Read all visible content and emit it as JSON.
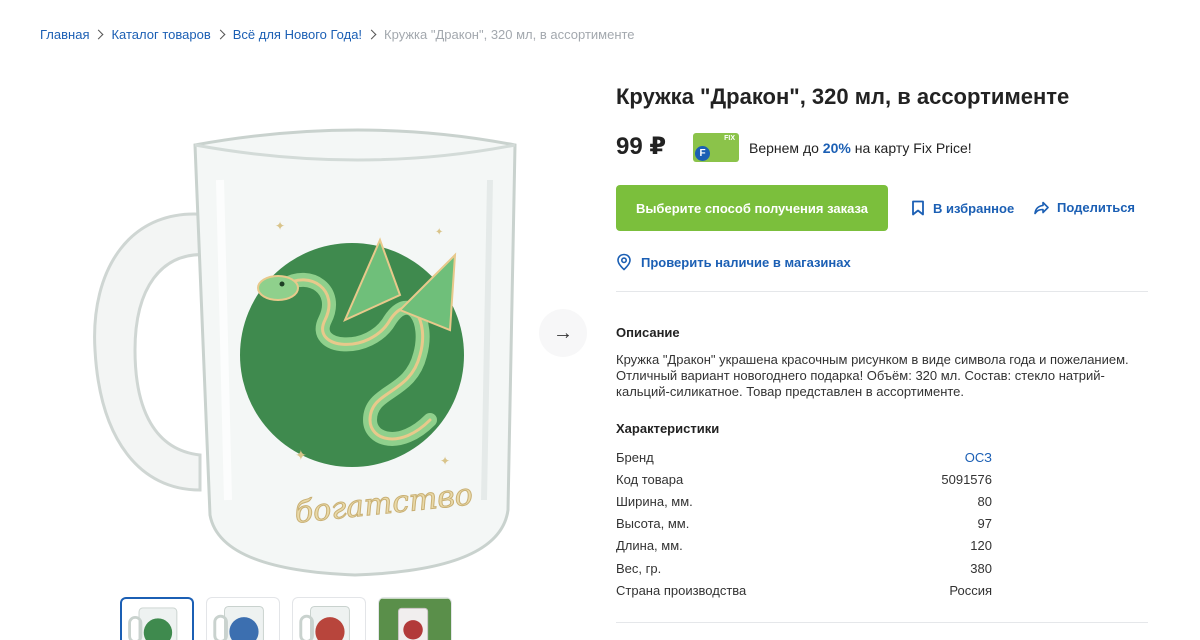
{
  "breadcrumb": {
    "items": [
      "Главная",
      "Каталог товаров",
      "Всё для Нового Года!"
    ],
    "current": "Кружка \"Дракон\", 320 мл, в ассортименте"
  },
  "product": {
    "title": "Кружка \"Дракон\", 320 мл, в ассортименте",
    "price": "99 ₽",
    "cashback": {
      "prefix": "Вернем до",
      "percent": "20%",
      "suffix": "на карту Fix Price!"
    },
    "card_label": "FIX",
    "card_letter": "F",
    "mug_text": "богатство"
  },
  "actions": {
    "order_button": "Выберите способ получения заказа",
    "favorite": "В избранное",
    "share": "Поделиться",
    "check_stores": "Проверить наличие в магазинах"
  },
  "description": {
    "heading": "Описание",
    "text": "Кружка \"Дракон\" украшена красочным рисунком в виде символа года и пожеланием. Отличный вариант новогоднего подарка! Объём: 320 мл. Состав: стекло натрий-кальций-силикатное. Товар представлен в ассортименте."
  },
  "specs": {
    "heading": "Характеристики",
    "rows": [
      {
        "label": "Бренд",
        "value": "ОСЗ"
      },
      {
        "label": "Код товара",
        "value": "5091576"
      },
      {
        "label": "Ширина, мм.",
        "value": "80"
      },
      {
        "label": "Высота, мм.",
        "value": "97"
      },
      {
        "label": "Длина, мм.",
        "value": "120"
      },
      {
        "label": "Вес, гр.",
        "value": "380"
      },
      {
        "label": "Страна производства",
        "value": "Россия"
      }
    ]
  },
  "gallery": {
    "next_arrow": "→",
    "thumbnail_colors": [
      "#3f8a4e",
      "#3c6fb0",
      "#b8453c",
      "#b23a3a"
    ]
  },
  "colors": {
    "link": "#1b5fb4",
    "order_button": "#7bbf3c",
    "fix_card": "#8bc34a",
    "dragon_circle": "#3f8a4e"
  }
}
